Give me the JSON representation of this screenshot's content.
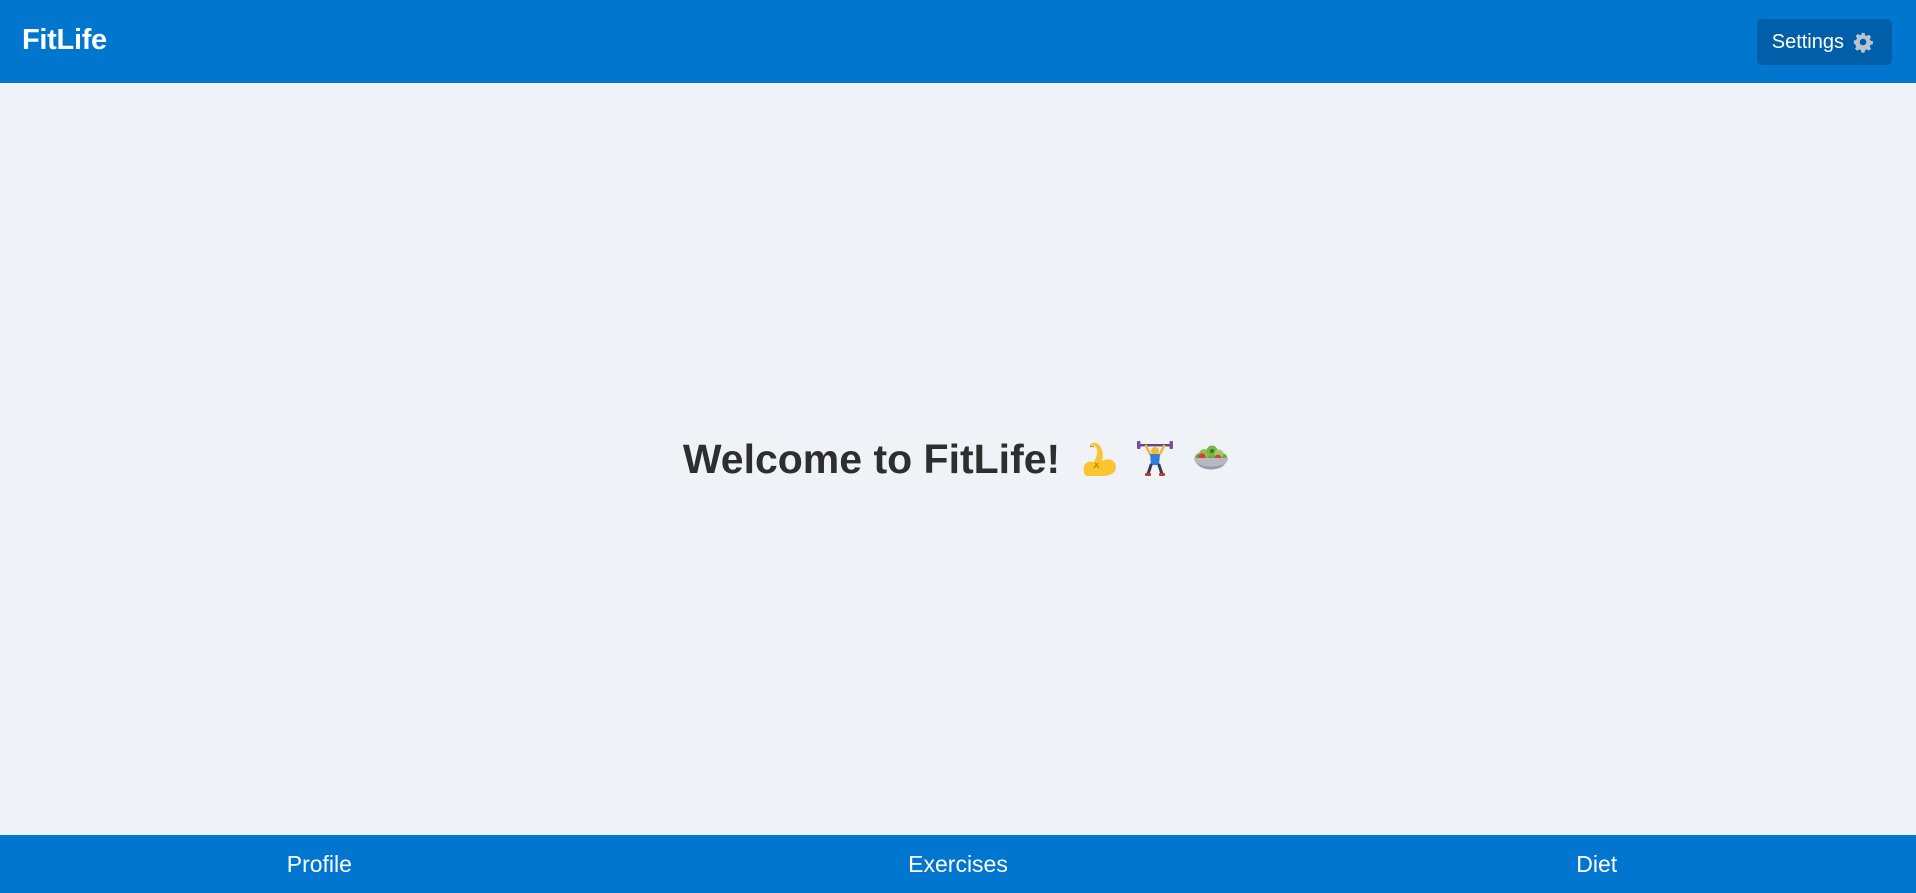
{
  "header": {
    "logo": "FitLife",
    "settings_label": "Settings",
    "settings_icon": "gear-icon"
  },
  "main": {
    "welcome_text": "Welcome to FitLife!",
    "emojis": [
      "flexed-biceps-icon",
      "weight-lifter-icon",
      "salad-icon"
    ]
  },
  "bottom_nav": {
    "items": [
      {
        "label": "Profile"
      },
      {
        "label": "Exercises"
      },
      {
        "label": "Diet"
      }
    ]
  },
  "colors": {
    "primary": "#0076cf",
    "button_dark": "#005fa8",
    "background": "#eff3f8",
    "text_dark": "#2e2e2e"
  }
}
